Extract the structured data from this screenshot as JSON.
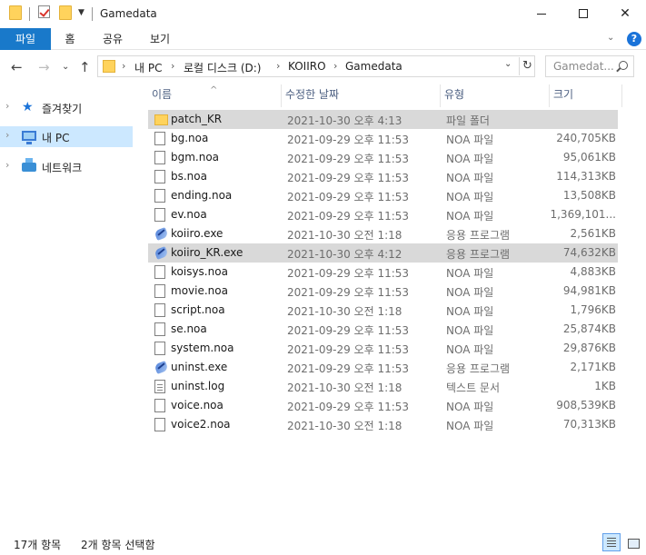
{
  "window": {
    "title": "Gamedata",
    "minimize_glyph": "",
    "maximize_glyph": "",
    "close_glyph": "✕"
  },
  "ribbon": {
    "tabs": [
      {
        "label": "파일",
        "active": true
      },
      {
        "label": "홈",
        "active": false
      },
      {
        "label": "공유",
        "active": false
      },
      {
        "label": "보기",
        "active": false
      }
    ],
    "expand_glyph": "⌄",
    "help_glyph": "?"
  },
  "nav": {
    "back_glyph": "←",
    "forward_glyph": "→",
    "recent_glyph": "⌄",
    "up_glyph": "↑"
  },
  "address": {
    "crumbs": [
      "내 PC",
      "로컬 디스크 (D:)",
      "KOIIRO",
      "Gamedata"
    ],
    "separator": "›",
    "dropdown_glyph": "⌄",
    "refresh_glyph": "↻"
  },
  "search": {
    "placeholder": "Gamedat..."
  },
  "navpane": {
    "items": [
      {
        "label": "즐겨찾기",
        "icon": "star-icon",
        "selected": false
      },
      {
        "label": "내 PC",
        "icon": "pc-icon",
        "selected": true
      },
      {
        "label": "네트워크",
        "icon": "network-icon",
        "selected": false
      }
    ],
    "chevron_glyph": "›"
  },
  "columns": {
    "name": "이름",
    "date": "수정한 날짜",
    "type": "유형",
    "size": "크기",
    "sort_glyph": "^"
  },
  "files": [
    {
      "name": "patch_KR",
      "date": "2021-10-30 오후 4:13",
      "type": "파일 폴더",
      "size": "",
      "icon": "folder-icon",
      "selected": true
    },
    {
      "name": "bg.noa",
      "date": "2021-09-29 오후 11:53",
      "type": "NOA 파일",
      "size": "240,705KB",
      "icon": "file-icon",
      "selected": false
    },
    {
      "name": "bgm.noa",
      "date": "2021-09-29 오후 11:53",
      "type": "NOA 파일",
      "size": "95,061KB",
      "icon": "file-icon",
      "selected": false
    },
    {
      "name": "bs.noa",
      "date": "2021-09-29 오후 11:53",
      "type": "NOA 파일",
      "size": "114,313KB",
      "icon": "file-icon",
      "selected": false
    },
    {
      "name": "ending.noa",
      "date": "2021-09-29 오후 11:53",
      "type": "NOA 파일",
      "size": "13,508KB",
      "icon": "file-icon",
      "selected": false
    },
    {
      "name": "ev.noa",
      "date": "2021-09-29 오후 11:53",
      "type": "NOA 파일",
      "size": "1,369,101...",
      "icon": "file-icon",
      "selected": false
    },
    {
      "name": "koiiro.exe",
      "date": "2021-10-30 오전 1:18",
      "type": "응용 프로그램",
      "size": "2,561KB",
      "icon": "exe-icon",
      "selected": false
    },
    {
      "name": "koiiro_KR.exe",
      "date": "2021-10-30 오후 4:12",
      "type": "응용 프로그램",
      "size": "74,632KB",
      "icon": "exe-icon",
      "selected": true
    },
    {
      "name": "koisys.noa",
      "date": "2021-09-29 오후 11:53",
      "type": "NOA 파일",
      "size": "4,883KB",
      "icon": "file-icon",
      "selected": false
    },
    {
      "name": "movie.noa",
      "date": "2021-09-29 오후 11:53",
      "type": "NOA 파일",
      "size": "94,981KB",
      "icon": "file-icon",
      "selected": false
    },
    {
      "name": "script.noa",
      "date": "2021-10-30 오전 1:18",
      "type": "NOA 파일",
      "size": "1,796KB",
      "icon": "file-icon",
      "selected": false
    },
    {
      "name": "se.noa",
      "date": "2021-09-29 오후 11:53",
      "type": "NOA 파일",
      "size": "25,874KB",
      "icon": "file-icon",
      "selected": false
    },
    {
      "name": "system.noa",
      "date": "2021-09-29 오후 11:53",
      "type": "NOA 파일",
      "size": "29,876KB",
      "icon": "file-icon",
      "selected": false
    },
    {
      "name": "uninst.exe",
      "date": "2021-09-29 오후 11:53",
      "type": "응용 프로그램",
      "size": "2,171KB",
      "icon": "exe-icon",
      "selected": false
    },
    {
      "name": "uninst.log",
      "date": "2021-10-30 오전 1:18",
      "type": "텍스트 문서",
      "size": "1KB",
      "icon": "text-file-icon",
      "selected": false
    },
    {
      "name": "voice.noa",
      "date": "2021-09-29 오후 11:53",
      "type": "NOA 파일",
      "size": "908,539KB",
      "icon": "file-icon",
      "selected": false
    },
    {
      "name": "voice2.noa",
      "date": "2021-10-30 오전 1:18",
      "type": "NOA 파일",
      "size": "70,313KB",
      "icon": "file-icon",
      "selected": false
    }
  ],
  "status": {
    "item_count": "17개 항목",
    "selected_count": "2개 항목 선택함"
  },
  "colors": {
    "accent": "#1979ca",
    "selection": "#d9d9d9",
    "nav_selection": "#cce8ff"
  }
}
